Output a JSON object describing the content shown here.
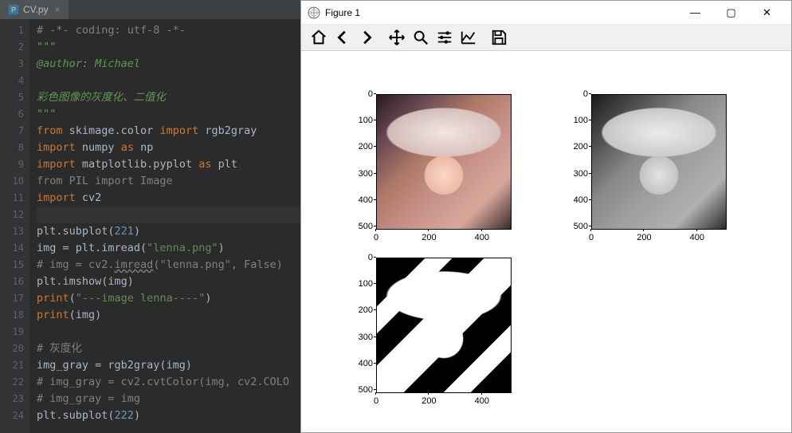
{
  "editor": {
    "tab": {
      "filename": "CV.py",
      "close_icon": "×"
    },
    "line_numbers": [
      1,
      2,
      3,
      4,
      5,
      6,
      7,
      8,
      9,
      10,
      11,
      12,
      13,
      14,
      15,
      16,
      17,
      18,
      19,
      20,
      21,
      22,
      23,
      24
    ],
    "lines": [
      {
        "t": [
          {
            "c": "t-gray",
            "s": "# -*- coding: utf-8 -*-"
          }
        ]
      },
      {
        "t": [
          {
            "c": "t-green",
            "s": "\"\"\""
          }
        ]
      },
      {
        "t": [
          {
            "c": "t-green",
            "s": "@author: Michael"
          }
        ]
      },
      {
        "t": []
      },
      {
        "t": [
          {
            "c": "t-green",
            "s": "彩色图像的灰度化、二值化"
          }
        ]
      },
      {
        "t": [
          {
            "c": "t-green",
            "s": "\"\"\""
          }
        ]
      },
      {
        "t": [
          {
            "c": "t-orange",
            "s": "from "
          },
          {
            "c": "t-white",
            "s": "skimage.color "
          },
          {
            "c": "t-orange",
            "s": "import "
          },
          {
            "c": "t-white",
            "s": "rgb2gray"
          }
        ]
      },
      {
        "t": [
          {
            "c": "t-orange",
            "s": "import "
          },
          {
            "c": "t-white",
            "s": "numpy "
          },
          {
            "c": "t-orange",
            "s": "as "
          },
          {
            "c": "t-white",
            "s": "np"
          }
        ]
      },
      {
        "t": [
          {
            "c": "t-orange",
            "s": "import "
          },
          {
            "c": "t-white",
            "s": "matplotlib.pyplot "
          },
          {
            "c": "t-orange",
            "s": "as "
          },
          {
            "c": "t-white",
            "s": "plt"
          }
        ]
      },
      {
        "t": [
          {
            "c": "t-gray",
            "s": "from PIL import Image"
          }
        ]
      },
      {
        "t": [
          {
            "c": "t-orange",
            "s": "import "
          },
          {
            "c": "t-white",
            "s": "cv2"
          }
        ]
      },
      {
        "hl": true,
        "t": []
      },
      {
        "t": [
          {
            "c": "t-white",
            "s": "plt.subplot("
          },
          {
            "c": "t-num",
            "s": "221"
          },
          {
            "c": "t-white",
            "s": ")"
          }
        ]
      },
      {
        "t": [
          {
            "c": "t-white",
            "s": "img = plt.imread("
          },
          {
            "c": "t-string",
            "s": "\"lenna.png\""
          },
          {
            "c": "t-white",
            "s": ")"
          }
        ]
      },
      {
        "t": [
          {
            "c": "t-gray",
            "s": "# img = cv2."
          },
          {
            "c": "t-gray t-squig",
            "s": "imread"
          },
          {
            "c": "t-gray",
            "s": "(\"lenna.png\", False)"
          }
        ]
      },
      {
        "t": [
          {
            "c": "t-white",
            "s": "plt.imshow(img)"
          }
        ]
      },
      {
        "t": [
          {
            "c": "t-orange",
            "s": "print"
          },
          {
            "c": "t-white",
            "s": "("
          },
          {
            "c": "t-string",
            "s": "\"---image lenna----\""
          },
          {
            "c": "t-white",
            "s": ")"
          }
        ]
      },
      {
        "t": [
          {
            "c": "t-orange",
            "s": "print"
          },
          {
            "c": "t-white",
            "s": "(img)"
          }
        ]
      },
      {
        "t": []
      },
      {
        "t": [
          {
            "c": "t-gray",
            "s": "# 灰度化"
          }
        ]
      },
      {
        "t": [
          {
            "c": "t-white",
            "s": "img_gray = rgb2gray(img)"
          }
        ]
      },
      {
        "t": [
          {
            "c": "t-gray",
            "s": "# img_gray = cv2.cvtColor(img, cv2.COLO"
          }
        ]
      },
      {
        "t": [
          {
            "c": "t-gray",
            "s": "# img_gray = img"
          }
        ]
      },
      {
        "t": [
          {
            "c": "t-white",
            "s": "plt.subplot("
          },
          {
            "c": "t-num",
            "s": "222"
          },
          {
            "c": "t-white",
            "s": ")"
          }
        ]
      }
    ]
  },
  "figure_window": {
    "title": "Figure 1",
    "win_buttons": {
      "min": "—",
      "max": "▢",
      "close": "✕"
    },
    "toolbar": {
      "home": "home-icon",
      "back": "back-icon",
      "forward": "forward-icon",
      "pan": "pan-icon",
      "zoom": "zoom-icon",
      "configure": "subplots-icon",
      "edit": "axes-icon",
      "save": "save-icon"
    }
  },
  "chart_data": [
    {
      "type": "heatmap",
      "description": "Color lenna image",
      "subplot": 221,
      "extent": [
        0,
        512,
        512,
        0
      ],
      "xticks": [
        0,
        200,
        400
      ],
      "yticks": [
        0,
        100,
        200,
        300,
        400,
        500
      ]
    },
    {
      "type": "heatmap",
      "description": "Grayscale lenna image",
      "subplot": 222,
      "extent": [
        0,
        512,
        512,
        0
      ],
      "xticks": [
        0,
        200,
        400
      ],
      "yticks": [
        0,
        100,
        200,
        300,
        400,
        500
      ]
    },
    {
      "type": "heatmap",
      "description": "Binary threshold lenna image",
      "subplot": 223,
      "extent": [
        0,
        512,
        512,
        0
      ],
      "xticks": [
        0,
        200,
        400
      ],
      "yticks": [
        0,
        100,
        200,
        300,
        400,
        500
      ]
    }
  ]
}
